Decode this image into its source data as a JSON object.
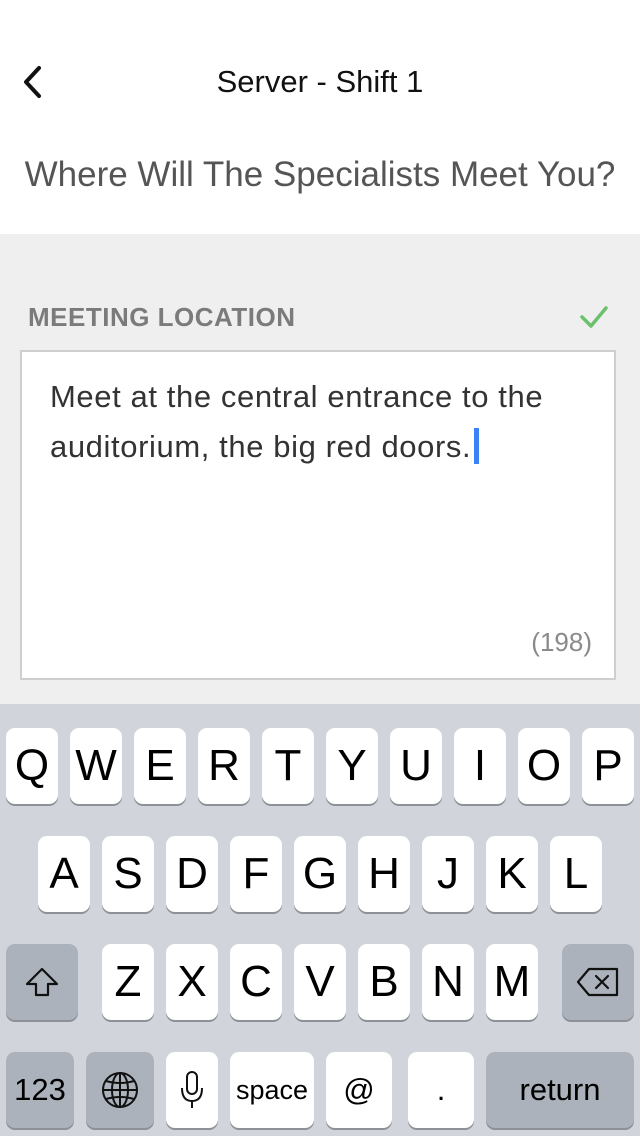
{
  "nav": {
    "title": "Server - Shift 1",
    "back_icon": "chevron-left-icon"
  },
  "page": {
    "question": "Where Will The Specialists Meet You?"
  },
  "field": {
    "label": "MEETING LOCATION",
    "value": "Meet at the central entrance to the auditorium, the big red doors.",
    "char_count": "(198)",
    "valid_icon": "checkmark-icon",
    "valid_color": "#6cc16c"
  },
  "keyboard": {
    "row1": [
      "Q",
      "W",
      "E",
      "R",
      "T",
      "Y",
      "U",
      "I",
      "O",
      "P"
    ],
    "row2": [
      "A",
      "S",
      "D",
      "F",
      "G",
      "H",
      "J",
      "K",
      "L"
    ],
    "row3": [
      "Z",
      "X",
      "C",
      "V",
      "B",
      "N",
      "M"
    ],
    "shift_icon": "shift-icon",
    "delete_icon": "backspace-icon",
    "numbers_label": "123",
    "globe_icon": "globe-icon",
    "mic_icon": "microphone-icon",
    "space_label": "space",
    "at_label": "@",
    "period_label": ".",
    "return_label": "return"
  }
}
